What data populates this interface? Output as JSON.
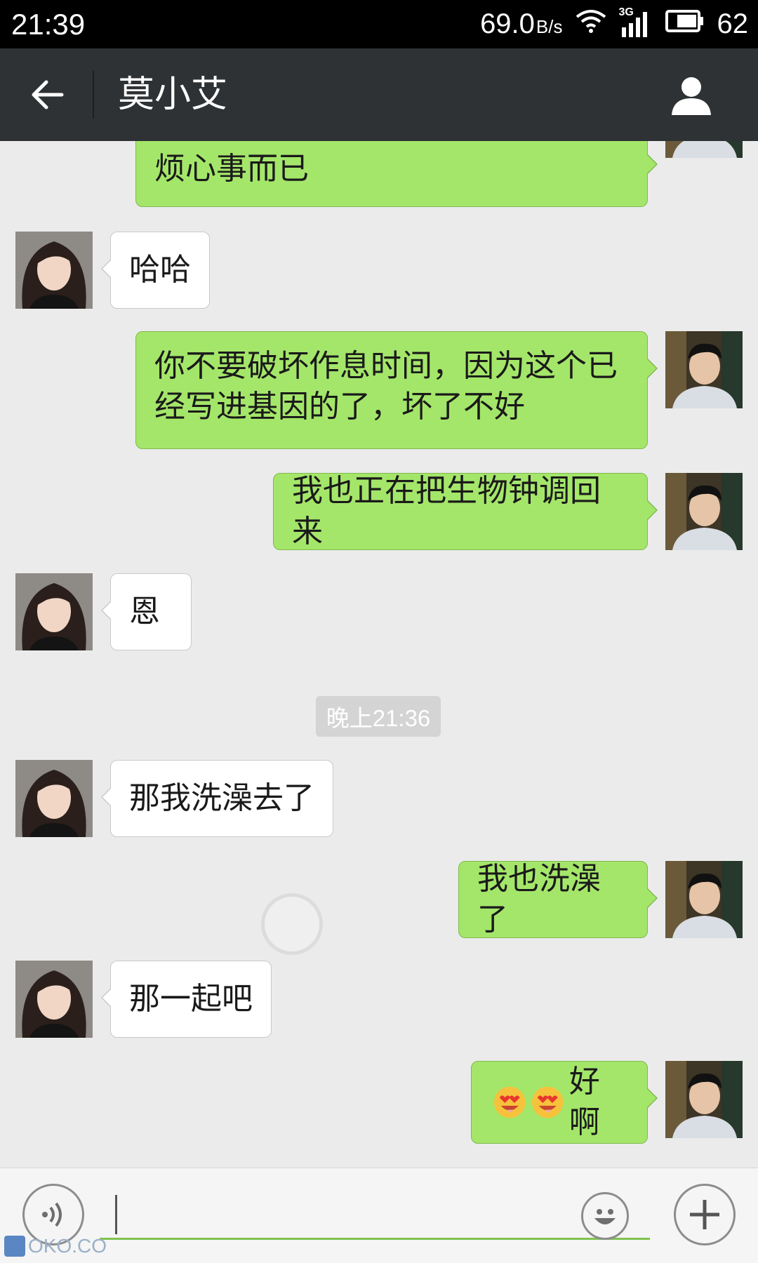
{
  "status_bar": {
    "time": "21:39",
    "data_speed": "69.0",
    "data_speed_unit": "B/s",
    "network": "3G",
    "battery": "62"
  },
  "header": {
    "contact_name": "莫小艾",
    "back_icon": "arrow-left-icon",
    "profile_icon": "person-icon"
  },
  "messages": [
    {
      "side": "out",
      "text": "烦心事而已"
    },
    {
      "side": "in",
      "text": "哈哈"
    },
    {
      "side": "out",
      "text": "你不要破坏作息时间，因为这个已经写进基因的了，坏了不好"
    },
    {
      "side": "out",
      "text": "我也正在把生物钟调回来"
    },
    {
      "side": "in",
      "text": "恩"
    },
    {
      "side": "in",
      "text": "那我洗澡去了"
    },
    {
      "side": "out",
      "text": "我也洗澡了"
    },
    {
      "side": "in",
      "text": "那一起吧"
    },
    {
      "side": "out",
      "text": "好啊",
      "emoji": [
        "heart-eyes-emoji",
        "heart-eyes-emoji"
      ]
    }
  ],
  "time_separator": "晚上21:36",
  "input_bar": {
    "voice_icon": "voice-icon",
    "message_value": "",
    "emoji_icon": "smiley-icon",
    "more_icon": "plus-icon"
  },
  "watermark": "OKO.CO",
  "colors": {
    "outgoing_bubble": "#a4e66a",
    "incoming_bubble": "#ffffff",
    "header": "#2e3234",
    "background": "#ebebeb"
  }
}
